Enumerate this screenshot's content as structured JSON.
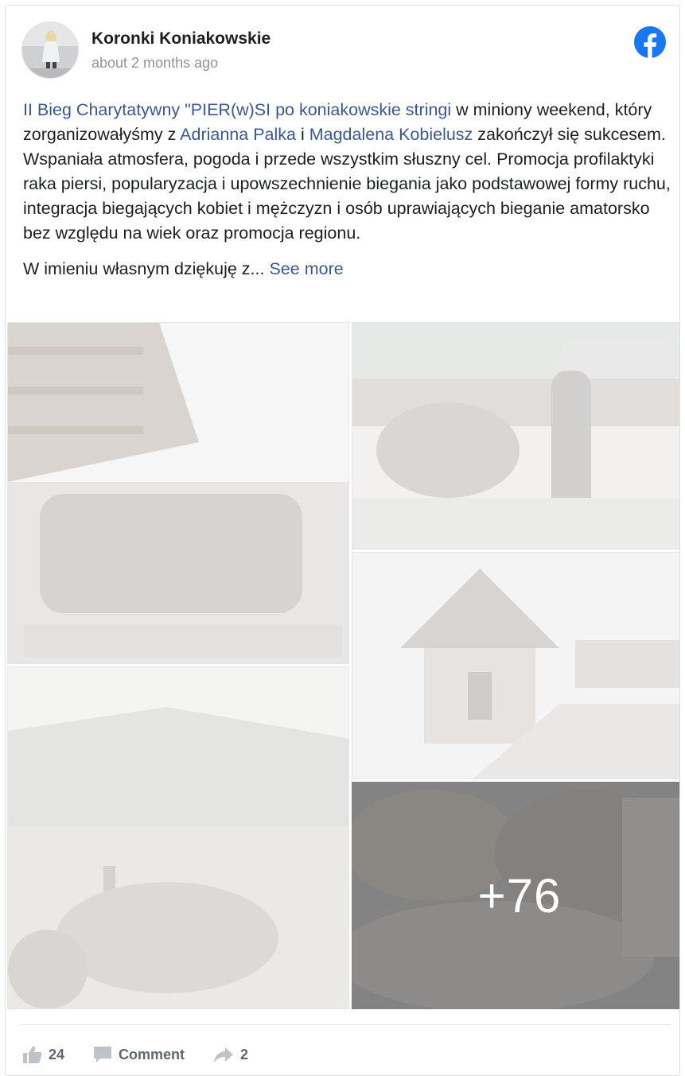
{
  "post": {
    "author_name": "Koronki Koniakowskie",
    "timestamp": "about 2 months ago",
    "brand_icon": "facebook-logo-icon",
    "brand_color": "#1877f2",
    "link_color": "#385898",
    "text": {
      "link_1": "II Bieg Charytatywny \"PIER(w)SI po koniakowskie stringi",
      "part_1": " w miniony weekend, który zorganizowałyśmy z ",
      "link_2": "Adrianna Palka",
      "part_2": " i ",
      "link_3": "Magdalena Kobielusz",
      "part_3": " zakończył się sukcesem. Wspaniała atmosfera, pogoda i przede wszystkim słuszny cel. Promocja profilaktyki raka piersi, popularyzacja i upowszechnienie biegania jako podstawowej formy ruchu, integracja biegających kobiet i mężczyzn i osób uprawiających bieganie amatorsko bez względu na wiek oraz promocja regionu.",
      "paragraph_2": " W imieniu własnym dziękuję z...",
      "see_more": "See more"
    },
    "photos": {
      "more_count": "+76"
    },
    "actions": {
      "like_count": "24",
      "comment_label": "Comment",
      "share_count": "2"
    }
  }
}
